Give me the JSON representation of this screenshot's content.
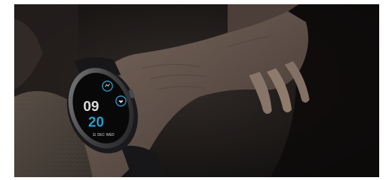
{
  "watch_face": {
    "hour": "09",
    "minute": "20",
    "date": "11 DEC",
    "weekday": "WED"
  },
  "colors": {
    "accent": "#2fb7e8",
    "background": "#1a1716"
  }
}
